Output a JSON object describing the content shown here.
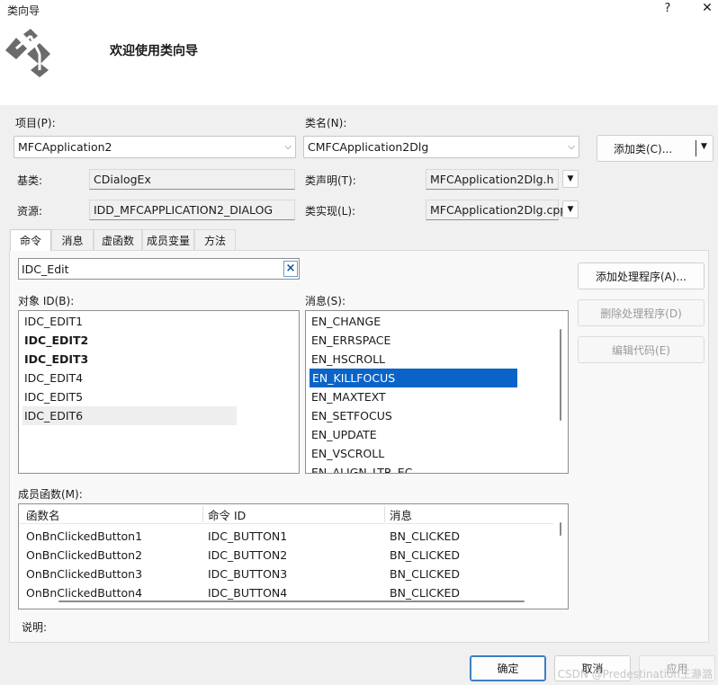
{
  "window": {
    "title": "类向导",
    "help_label": "?",
    "close_label": "✕"
  },
  "header": {
    "title": "欢迎使用类向导"
  },
  "form": {
    "project_label": "项目(P):",
    "project_value": "MFCApplication2",
    "classname_label": "类名(N):",
    "classname_value": "CMFCApplication2Dlg",
    "add_class_label": "添加类(C)...",
    "base_label": "基类:",
    "base_value": "CDialogEx",
    "decl_label": "类声明(T):",
    "decl_value": "MFCApplication2Dlg.h",
    "resource_label": "资源:",
    "resource_value": "IDD_MFCAPPLICATION2_DIALOG",
    "impl_label": "类实现(L):",
    "impl_value": "MFCApplication2Dlg.cpp"
  },
  "tabs": [
    "命令",
    "消息",
    "虚函数",
    "成员变量",
    "方法"
  ],
  "commands": {
    "search_value": "IDC_Edit",
    "clear_icon": "×",
    "objects_label": "对象 ID(B):",
    "objects": [
      {
        "label": "IDC_EDIT1",
        "bold": false
      },
      {
        "label": "IDC_EDIT2",
        "bold": true
      },
      {
        "label": "IDC_EDIT3",
        "bold": true
      },
      {
        "label": "IDC_EDIT4",
        "bold": false
      },
      {
        "label": "IDC_EDIT5",
        "bold": false
      },
      {
        "label": "IDC_EDIT6",
        "bold": false
      }
    ],
    "objects_selected_index": 5,
    "messages_label": "消息(S):",
    "messages": [
      "EN_CHANGE",
      "EN_ERRSPACE",
      "EN_HSCROLL",
      "EN_KILLFOCUS",
      "EN_MAXTEXT",
      "EN_SETFOCUS",
      "EN_UPDATE",
      "EN_VSCROLL",
      "EN_ALIGN_LTR_EC"
    ],
    "messages_selected_index": 3,
    "add_handler_label": "添加处理程序(A)...",
    "delete_handler_label": "删除处理程序(D)",
    "edit_code_label": "编辑代码(E)",
    "members_label": "成员函数(M):",
    "members_columns": [
      "函数名",
      "命令 ID",
      "消息"
    ],
    "members_rows": [
      [
        "OnBnClickedButton1",
        "IDC_BUTTON1",
        "BN_CLICKED"
      ],
      [
        "OnBnClickedButton2",
        "IDC_BUTTON2",
        "BN_CLICKED"
      ],
      [
        "OnBnClickedButton3",
        "IDC_BUTTON3",
        "BN_CLICKED"
      ],
      [
        "OnBnClickedButton4",
        "IDC_BUTTON4",
        "BN_CLICKED"
      ]
    ],
    "description_label": "说明:"
  },
  "footer": {
    "ok_label": "确定",
    "cancel_label": "取消",
    "apply_label": "应用",
    "watermark": "CSDN @Predestination王瀞潞"
  },
  "colors": {
    "selection": "#0a64c8",
    "primary_border": "#3b7fc4",
    "panel_bg": "#f0f0f0"
  }
}
